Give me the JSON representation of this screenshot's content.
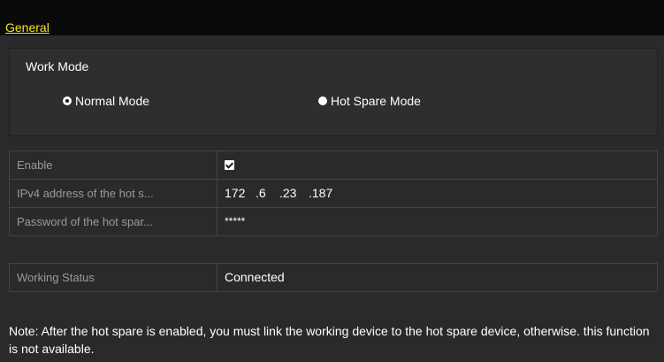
{
  "tabs": {
    "general": "General"
  },
  "work_mode": {
    "title": "Work Mode",
    "options": [
      {
        "label": "Normal Mode",
        "selected": true
      },
      {
        "label": "Hot Spare Mode",
        "selected": false
      }
    ]
  },
  "settings": {
    "enable_label": "Enable",
    "enable_checked": true,
    "ipv4_label": "IPv4 address of the hot s...",
    "ipv4_segments": [
      "172",
      ".6",
      ".23",
      ".187"
    ],
    "password_label": "Password of the hot spar...",
    "password_value": "*****"
  },
  "status": {
    "label": "Working Status",
    "value": "Connected"
  },
  "note": "Note: After the hot spare is enabled, you must link the working device to the hot spare device, otherwise. this function is not available.",
  "colors": {
    "tab_active": "#f5e61e",
    "background": "#2a2a2a",
    "label_text": "#9a9a9a"
  }
}
